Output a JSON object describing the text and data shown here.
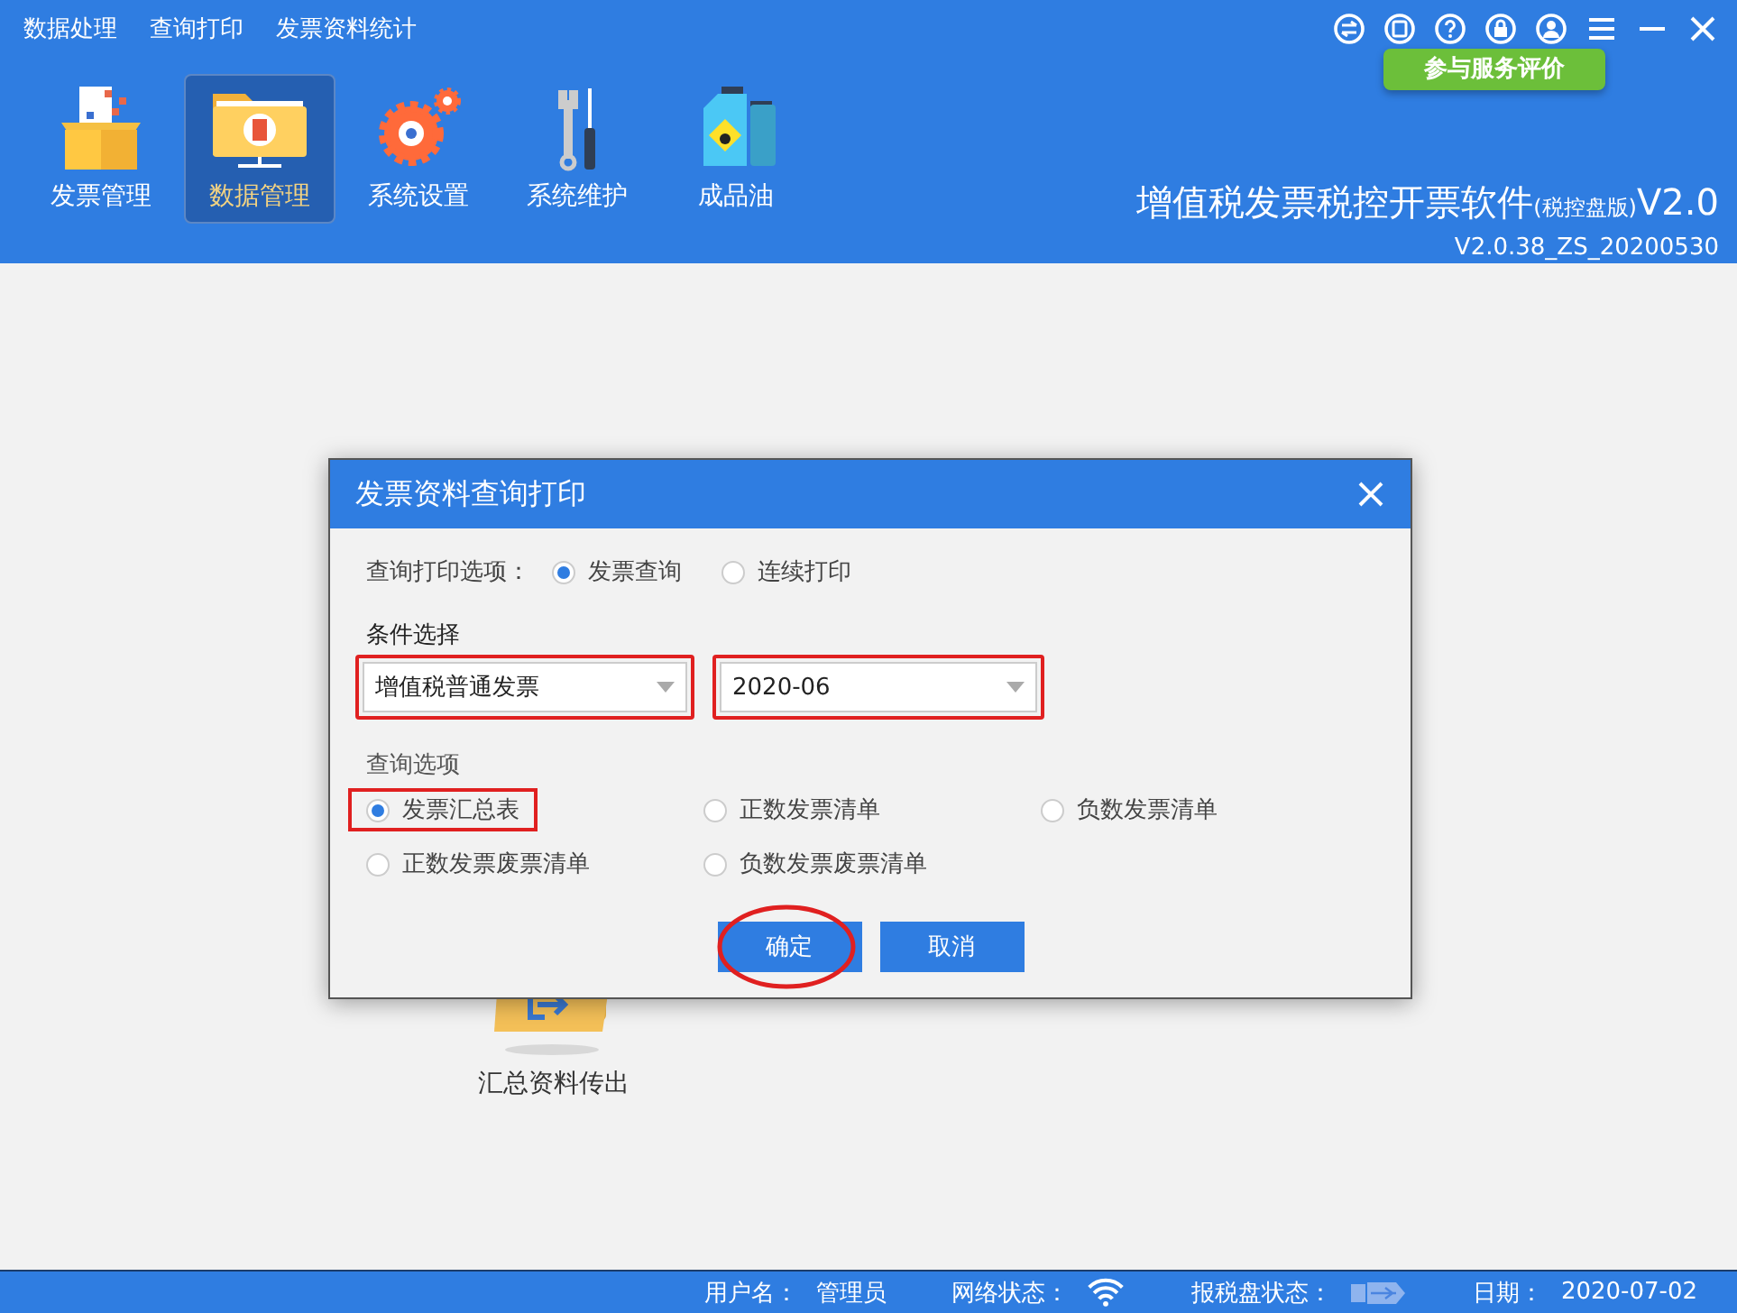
{
  "menu": [
    "数据处理",
    "查询打印",
    "发票资料统计"
  ],
  "toolbar": [
    {
      "kind": "box",
      "label": "发票管理",
      "selected": false
    },
    {
      "kind": "folder",
      "label": "数据管理",
      "selected": true
    },
    {
      "kind": "gear",
      "label": "系统设置",
      "selected": false
    },
    {
      "kind": "tools",
      "label": "系统维护",
      "selected": false
    },
    {
      "kind": "oil",
      "label": "成品油",
      "selected": false
    }
  ],
  "tooltip": "参与服务评价",
  "product": {
    "title": "增值税发票税控开票软件",
    "edition": "(税控盘版)",
    "suffix": "V2.0",
    "version": "V2.0.38_ZS_20200530"
  },
  "content": {
    "items": [
      {
        "label": "汇总资料传出"
      }
    ]
  },
  "dialog": {
    "title": "发票资料查询打印",
    "print_option": {
      "label": "查询打印选项：",
      "options": [
        {
          "label": "发票查询",
          "selected": true
        },
        {
          "label": "连续打印",
          "selected": false
        }
      ]
    },
    "condition": {
      "label": "条件选择",
      "selects": [
        {
          "value": "增值税普通发票",
          "highlighted": true
        },
        {
          "value": "2020-06",
          "highlighted": true
        }
      ]
    },
    "query": {
      "label": "查询选项",
      "options": [
        {
          "label": "发票汇总表",
          "selected": true,
          "highlighted": true
        },
        {
          "label": "正数发票清单",
          "selected": false,
          "highlighted": false
        },
        {
          "label": "负数发票清单",
          "selected": false,
          "highlighted": false
        },
        {
          "label": "正数发票废票清单",
          "selected": false,
          "highlighted": false
        },
        {
          "label": "负数发票废票清单",
          "selected": false,
          "highlighted": false
        }
      ]
    },
    "buttons": [
      {
        "label": "确定",
        "circled": true
      },
      {
        "label": "取消",
        "circled": false
      }
    ]
  },
  "status_bar": [
    {
      "kind": "text",
      "label": "用户名：",
      "value": "管理员"
    },
    {
      "kind": "wifi",
      "label": "网络状态："
    },
    {
      "kind": "disk",
      "label": "报税盘状态："
    },
    {
      "kind": "text",
      "label": "日期：",
      "value": "2020-07-02"
    }
  ]
}
